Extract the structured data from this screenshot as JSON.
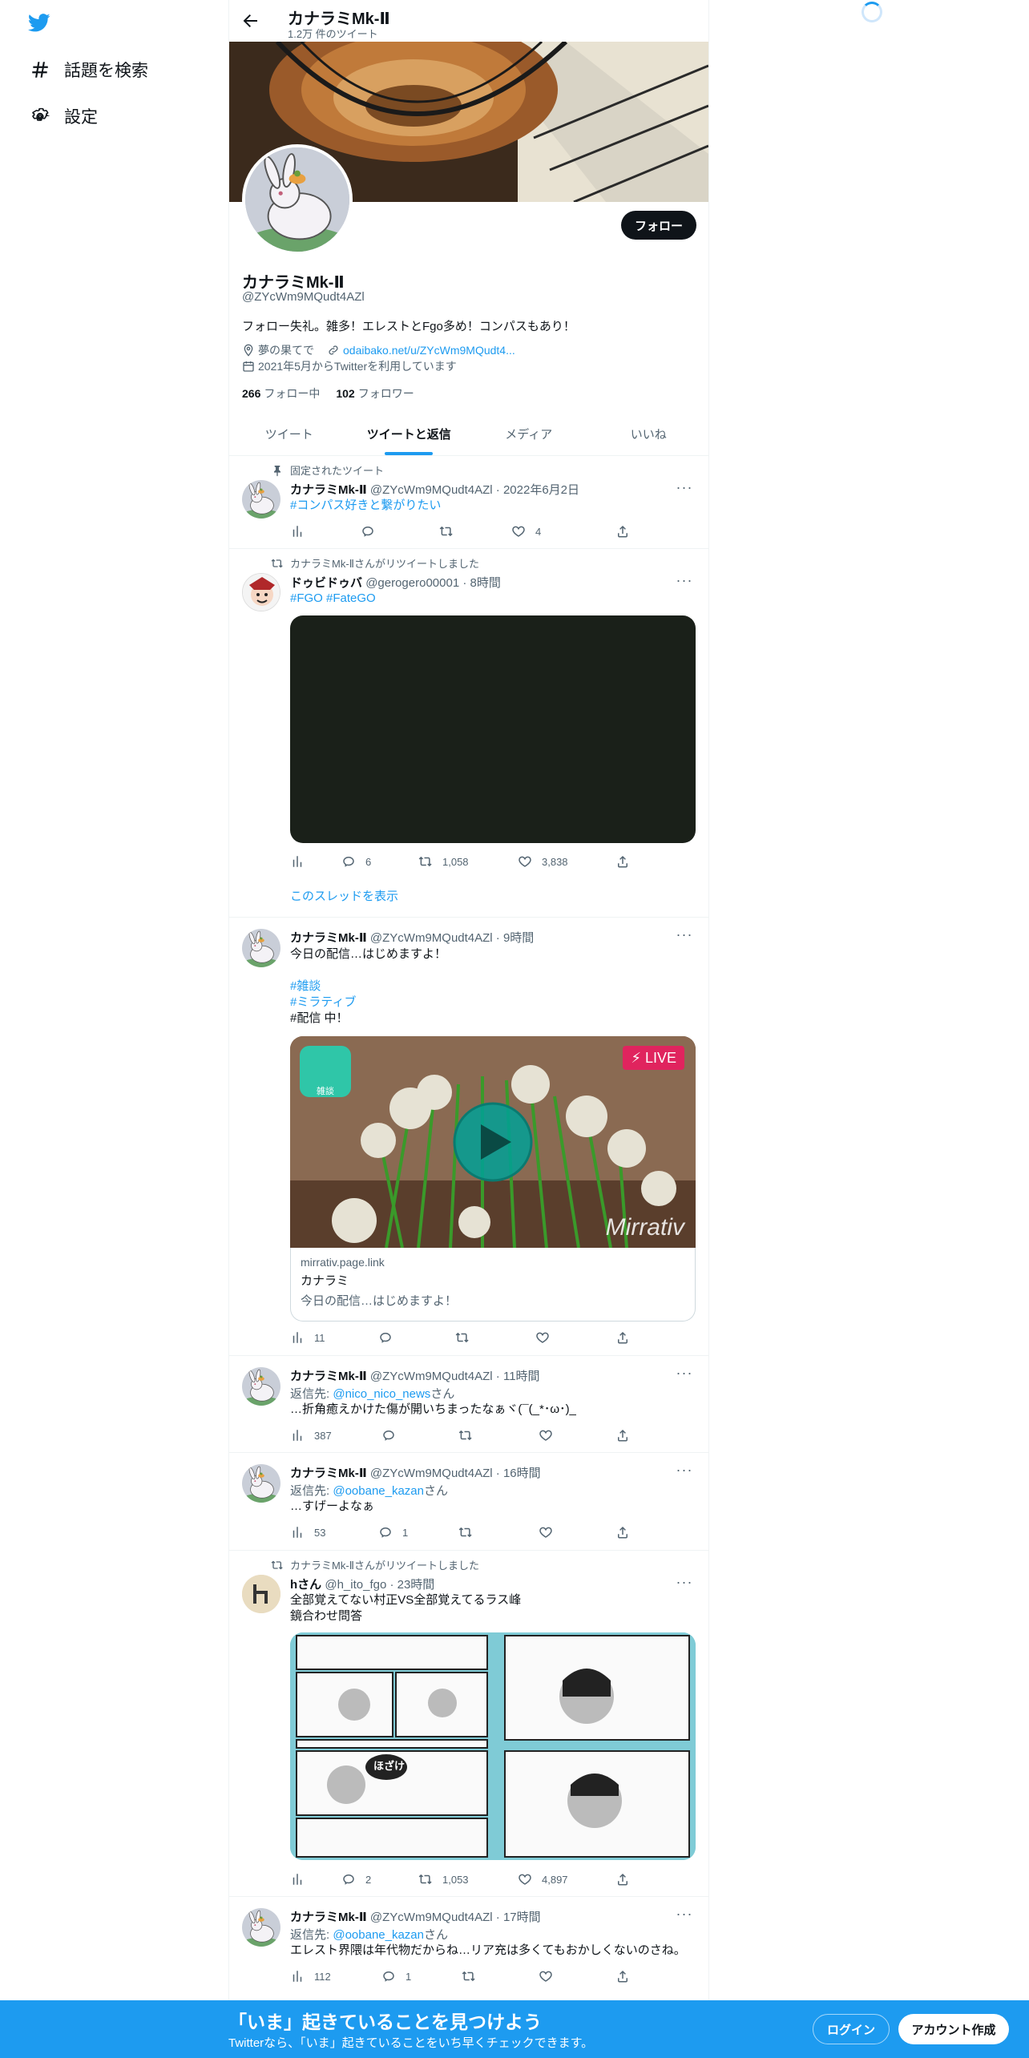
{
  "nav": {
    "explore_label": "話題を検索",
    "settings_label": "設定"
  },
  "topbar": {
    "name": "カナラミMk-Ⅱ",
    "tweet_count": "1.2万 件のツイート"
  },
  "profile": {
    "name": "カナラミMk-Ⅱ",
    "handle": "@ZYcWm9MQudt4AZl",
    "follow_label": "フォロー",
    "bio": "フォロー失礼。雑多！エレストとFgo多め！コンパスもあり！",
    "location": "夢の果てで",
    "link": "odaibako.net/u/ZYcWm9MQudt4...",
    "joined": "2021年5月からTwitterを利用しています",
    "following_count": "266",
    "following_label": "フォロー中",
    "followers_count": "102",
    "followers_label": "フォロワー"
  },
  "tabs": [
    "ツイート",
    "ツイートと返信",
    "メディア",
    "いいね"
  ],
  "tweets": [
    {
      "context": "固定されたツイート",
      "name": "カナラミMk-Ⅱ",
      "meta": "@ZYcWm9MQudt4AZl · 2022年6月2日",
      "text": "#コンパス好きと繋がりたい",
      "views": "",
      "replies": "",
      "retweets": "",
      "likes": "4"
    },
    {
      "context": "カナラミMk-Ⅱさんがリツイートしました",
      "name": "ドゥビドゥバ",
      "meta": "@gerogero00001 · 8時間",
      "text": "#FGO #FateGO",
      "views": "",
      "replies": "6",
      "retweets": "1,058",
      "likes": "3,838",
      "thread_link": "このスレッドを表示"
    },
    {
      "name": "カナラミMk-Ⅱ",
      "meta": "@ZYcWm9MQudt4AZl · 9時間",
      "text_lines": [
        "今日の配信…はじめますよ！",
        "",
        "#雑談",
        "#ミラティブ",
        "#配信 中！"
      ],
      "live_label": "LIVE",
      "app_label": "雑談",
      "watermark": "Mirrativ",
      "card_domain": "mirrativ.page.link",
      "card_title": "カナラミ",
      "card_desc": "今日の配信…はじめますよ！",
      "views": "11",
      "replies": "",
      "retweets": "",
      "likes": ""
    },
    {
      "name": "カナラミMk-Ⅱ",
      "meta": "@ZYcWm9MQudt4AZl · 11時間",
      "reply_prefix": "返信先: ",
      "reply_to": "@nico_nico_news",
      "reply_suffix": "さん",
      "text": "…折角癒えかけた傷が開いちまったなぁヾ(¯(_*･ω･)_",
      "views": "387",
      "replies": "",
      "retweets": "",
      "likes": ""
    },
    {
      "name": "カナラミMk-Ⅱ",
      "meta": "@ZYcWm9MQudt4AZl · 16時間",
      "reply_prefix": "返信先: ",
      "reply_to": "@oobane_kazan",
      "reply_suffix": "さん",
      "text": "…すげーよなぁ",
      "views": "53",
      "replies": "1",
      "retweets": "",
      "likes": ""
    },
    {
      "context": "カナラミMk-Ⅱさんがリツイートしました",
      "name": "hさん",
      "meta": "@h_ito_fgo · 23時間",
      "text_lines": [
        "全部覚えてない村正VS全部覚えてるラス峰",
        "鏡合わせ問答"
      ],
      "bubble_text": "ほざけ",
      "views": "",
      "replies": "2",
      "retweets": "1,053",
      "likes": "4,897"
    },
    {
      "name": "カナラミMk-Ⅱ",
      "meta": "@ZYcWm9MQudt4AZl · 17時間",
      "reply_prefix": "返信先: ",
      "reply_to": "@oobane_kazan",
      "reply_suffix": "さん",
      "text": "エレスト界隈は年代物だからね…リア充は多くてもおかしくないのさね。",
      "views": "112",
      "replies": "1",
      "retweets": "",
      "likes": ""
    }
  ],
  "bottombar": {
    "title": "「いま」起きていることを見つけよう",
    "subtitle": "Twitterなら、「いま」起きていることをいち早くチェックできます。",
    "login_label": "ログイン",
    "signup_label": "アカウント作成"
  },
  "colors": {
    "accent": "#1d9bf0",
    "text": "#0f1419",
    "secondary": "#536471",
    "live_red": "#e0245e"
  }
}
